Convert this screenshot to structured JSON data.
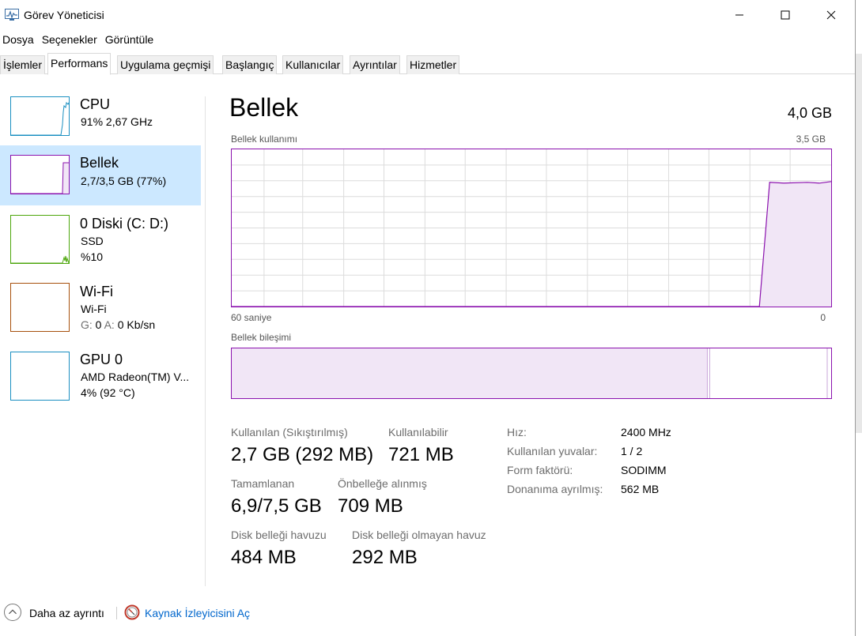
{
  "window": {
    "title": "Görev Yöneticisi",
    "controls": [
      "minimize-icon",
      "maximize-icon",
      "close-icon"
    ]
  },
  "menu": [
    "Dosya",
    "Seçenekler",
    "Görüntüle"
  ],
  "tabs": [
    {
      "label": "İşlemler",
      "active": false
    },
    {
      "label": "Performans",
      "active": true
    },
    {
      "label": "Uygulama geçmişi",
      "active": false
    },
    {
      "label": "Başlangıç",
      "active": false
    },
    {
      "label": "Kullanıcılar",
      "active": false
    },
    {
      "label": "Ayrıntılar",
      "active": false
    },
    {
      "label": "Hizmetler",
      "active": false
    }
  ],
  "sidebar": {
    "items": [
      {
        "name": "CPU",
        "line1": "91%  2,67 GHz",
        "color": "#1a8fc1"
      },
      {
        "name": "Bellek",
        "line1": "2,7/3,5 GB (77%)",
        "color": "#8b12ae",
        "selected": true
      },
      {
        "name": "0 Diski (C: D:)",
        "line1": "SSD",
        "line2": "%10",
        "color": "#4da60c"
      },
      {
        "name": "Wi-Fi",
        "line1": "Wi-Fi",
        "line2_prefix_g": "G:",
        "line2_g": "0",
        "line2_prefix_a": "A:",
        "line2_a": "0 Kb/sn",
        "color": "#a7500c"
      },
      {
        "name": "GPU 0",
        "line1": "AMD Radeon(TM) V...",
        "line2": "4% (92 °C)",
        "color": "#1a8fc1"
      }
    ]
  },
  "main": {
    "title": "Bellek",
    "total": "4,0 GB",
    "usage_label": "Bellek kullanımı",
    "usage_max": "3,5 GB",
    "time_left": "60 saniye",
    "time_right": "0",
    "composition_label": "Bellek bileşimi",
    "accent": "#8b12ae",
    "usage_fraction_recent": 0.79,
    "stats": {
      "in_use_label": "Kullanılan (Sıkıştırılmış)",
      "in_use_value": "2,7 GB (292 MB)",
      "available_label": "Kullanılabilir",
      "available_value": "721 MB",
      "committed_label": "Tamamlanan",
      "committed_value": "6,9/7,5 GB",
      "cached_label": "Önbelleğe alınmış",
      "cached_value": "709 MB",
      "paged_label": "Disk belleği havuzu",
      "paged_value": "484 MB",
      "nonpaged_label": "Disk belleği olmayan havuz",
      "nonpaged_value": "292 MB"
    },
    "details": {
      "speed_label": "Hız:",
      "speed_value": "2400 MHz",
      "slots_label": "Kullanılan yuvalar:",
      "slots_value": "1 / 2",
      "form_label": "Form faktörü:",
      "form_value": "SODIMM",
      "reserved_label": "Donanıma ayrılmış:",
      "reserved_value": "562 MB"
    }
  },
  "footer": {
    "fewer_details": "Daha az ayrıntı",
    "resource_monitor": "Kaynak İzleyicisini Aç"
  }
}
